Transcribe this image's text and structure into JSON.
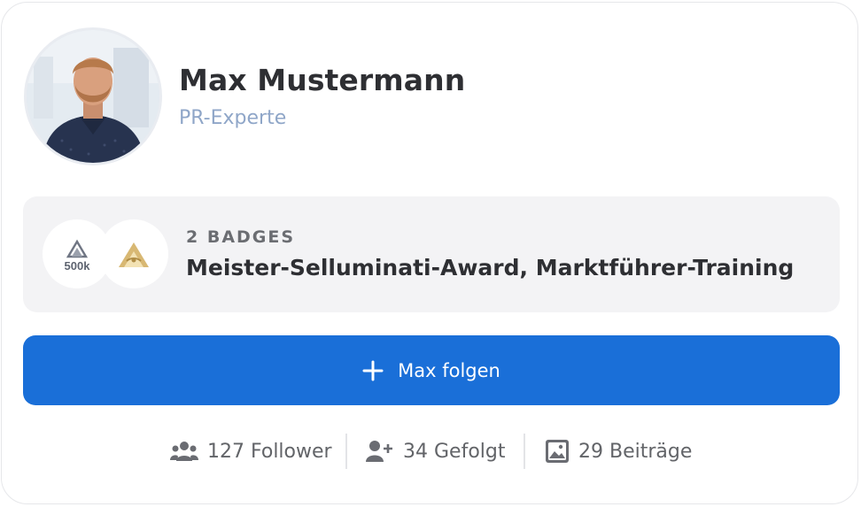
{
  "profile": {
    "name": "Max Mustermann",
    "role": "PR-Experte",
    "avatar_alt": "profile-photo"
  },
  "badges": {
    "count_label": "2 BADGES",
    "names": "Meister-Selluminati-Award, Marktführer-Training",
    "items": [
      {
        "icon": "mountain-500k-badge-icon",
        "text": "500k"
      },
      {
        "icon": "golden-pyramid-badge-icon"
      }
    ]
  },
  "follow_button": {
    "label": "Max folgen",
    "icon": "plus-icon",
    "color": "#1a6fd8"
  },
  "stats": [
    {
      "icon": "users-icon",
      "label": "127 Follower"
    },
    {
      "icon": "user-plus-icon",
      "label": "34 Gefolgt"
    },
    {
      "icon": "image-icon",
      "label": "29 Beiträge"
    }
  ],
  "colors": {
    "name_text": "#2e2f33",
    "role_text": "#8fa6c8",
    "badge_bg": "#f3f3f5",
    "accent": "#1a6fd8"
  }
}
